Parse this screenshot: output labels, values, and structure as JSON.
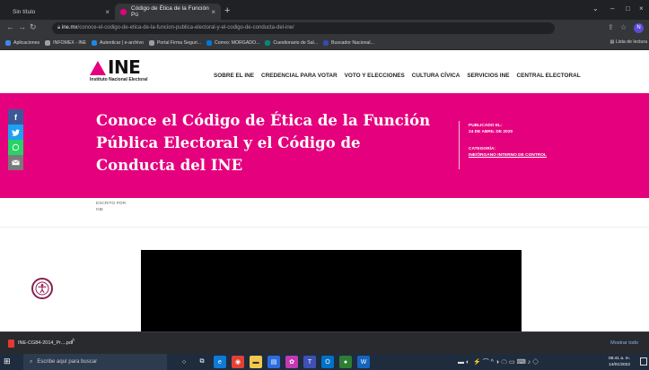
{
  "browser": {
    "tabs": [
      {
        "label": "Sin título"
      },
      {
        "label": "Código de Ética de la Función Pú"
      }
    ],
    "new_tab": "+",
    "url_host": "ine.mx",
    "url_path": "/conoce-el-codigo-de-etica-de-la-funcion-publica-electoral-y-el-codigo-de-conducta-del-ine/",
    "profile_initial": "N",
    "bookmarks": [
      {
        "label": "Aplicaciones",
        "color": "#4285f4"
      },
      {
        "label": "INFOMEX - INE",
        "color": "#5f6368"
      },
      {
        "label": "Autenticar | e-archivo",
        "color": "#1e88e5"
      },
      {
        "label": "Portal Firma Seguri...",
        "color": "#5f6368"
      },
      {
        "label": "Correo: MORGADO...",
        "color": "#0078d4"
      },
      {
        "label": "Cuestionario de Sal...",
        "color": "#00897b"
      },
      {
        "label": "Buscador Nacional...",
        "color": "#3949ab"
      }
    ],
    "reading_list": "Lista de lectura"
  },
  "site": {
    "logo_word": "INE",
    "logo_sub": "Instituto Nacional Electoral",
    "nav": [
      {
        "label": "SOBRE EL INE"
      },
      {
        "label": "CREDENCIAL PARA VOTAR"
      },
      {
        "label": "VOTO Y ELECCIONES"
      },
      {
        "label": "CULTURA CÍVICA"
      },
      {
        "label": "SERVICIOS INE"
      },
      {
        "label": "CENTRAL ELECTORAL"
      }
    ]
  },
  "article": {
    "title": "Conoce el Código de Ética de la Función Pública Electoral y el Código de Conducta del INE",
    "published_label": "PUBLICADO EL:",
    "published_date": "24 DE ABRIL DE 2020",
    "category_label": "CATEGORÍA:",
    "category_value": "INE/ÓRGANO INTERNO DE CONTROL",
    "author_label": "ESCRITO POR:",
    "author_value": "INE",
    "share": [
      {
        "glyph": "f"
      },
      {
        "glyph": "t"
      },
      {
        "glyph": "w"
      },
      {
        "glyph": "✉"
      }
    ]
  },
  "downloads": {
    "file_name": "INE-CG84-2014_Pr....pdf",
    "show_all": "Mostrar todo"
  },
  "taskbar": {
    "search_placeholder": "Escribe aquí para buscar",
    "time": "06:41 a. m.",
    "date": "14/01/2022"
  },
  "colors": {
    "ine_pink": "#e5007d",
    "taskbar": "#1f2c3d"
  }
}
